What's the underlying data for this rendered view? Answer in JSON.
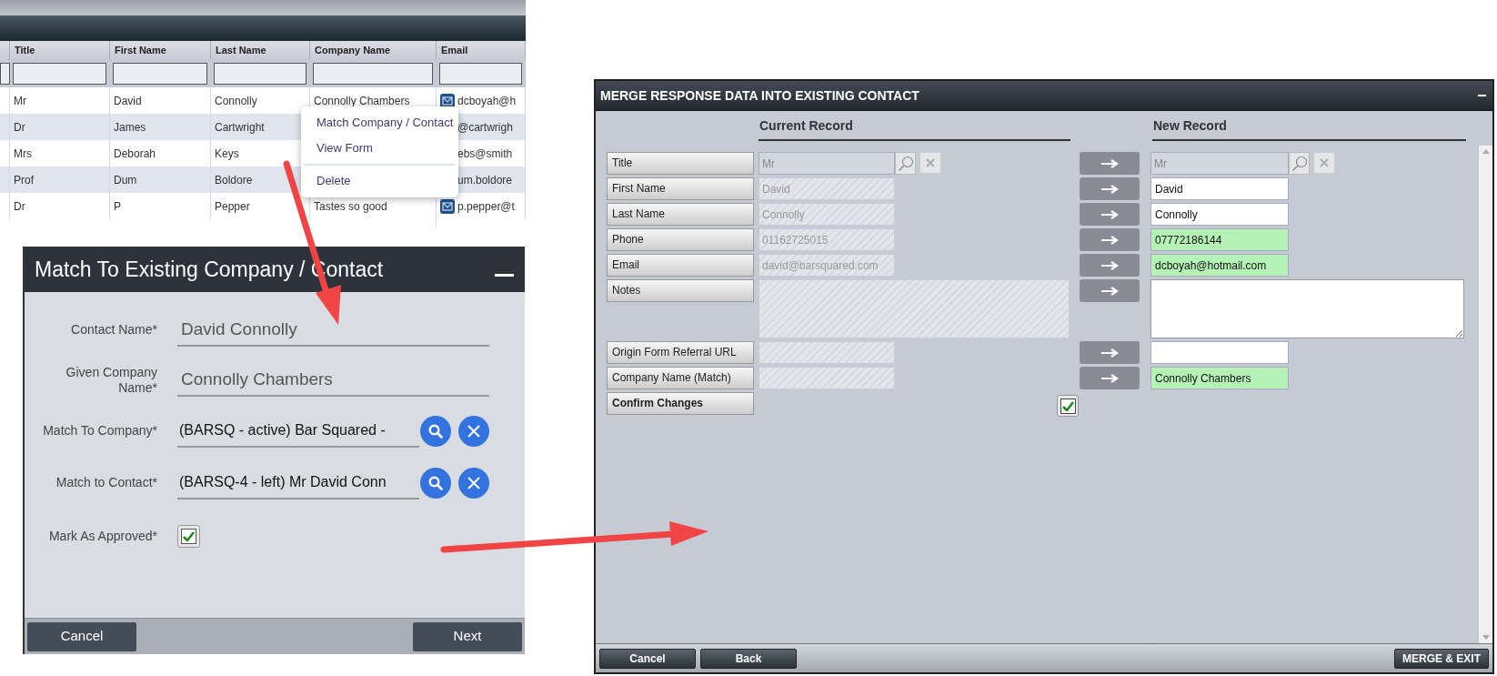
{
  "contacts_grid": {
    "columns": [
      "Title",
      "First Name",
      "Last Name",
      "Company Name",
      "Email"
    ],
    "rows": [
      {
        "title": "Mr",
        "first_name": "David",
        "last_name": "Connolly",
        "company": "Connolly Chambers",
        "email": "dcboyah@h",
        "mail_icon": true
      },
      {
        "title": "Dr",
        "first_name": "James",
        "last_name": "Cartwright",
        "email": "@cartwrigh",
        "mail_icon": false
      },
      {
        "title": "Mrs",
        "first_name": "Deborah",
        "last_name": "Keys",
        "email": "ebs@smith",
        "mail_icon": false
      },
      {
        "title": "Prof",
        "first_name": "Dum",
        "last_name": "Boldore",
        "email": "um.boldore",
        "mail_icon": false
      },
      {
        "title": "Dr",
        "first_name": "P",
        "last_name": "Pepper",
        "company": "Tastes so good",
        "email": "p.pepper@t",
        "mail_icon": true
      }
    ]
  },
  "context_menu": {
    "items": [
      {
        "kind": "item",
        "label": "Match Company / Contact"
      },
      {
        "kind": "item",
        "label": "View Form"
      },
      {
        "kind": "separator"
      },
      {
        "kind": "item",
        "label": "Delete"
      }
    ]
  },
  "match_dialog": {
    "title": "Match To Existing Company / Contact",
    "fields": [
      {
        "kind": "text",
        "label": "Contact Name*",
        "value": "David Connolly"
      },
      {
        "kind": "text",
        "label": "Given Company Name*",
        "value": "Connolly Chambers"
      },
      {
        "kind": "lookup",
        "label": "Match To Company*",
        "value": "(BARSQ - active) Bar Squared -"
      },
      {
        "kind": "lookup",
        "label": "Match to Contact*",
        "value": "(BARSQ-4 - left) Mr David Conn"
      },
      {
        "kind": "checkbox",
        "label": "Mark As Approved*",
        "checked": true
      }
    ],
    "buttons": [
      "Cancel",
      "Next"
    ]
  },
  "merge_dialog": {
    "title": "MERGE RESPONSE DATA INTO EXISTING CONTACT",
    "current_header": "Current Record",
    "new_header": "New Record",
    "rows": [
      {
        "label": "Title",
        "kind": "lookup",
        "current": "Mr",
        "new": "Mr"
      },
      {
        "label": "First Name",
        "kind": "text",
        "current": "David",
        "new": "David",
        "changed": false
      },
      {
        "label": "Last Name",
        "kind": "text",
        "current": "Connolly",
        "new": "Connolly",
        "changed": false
      },
      {
        "label": "Phone",
        "kind": "text",
        "current": "01162725015",
        "new": "07772186144",
        "changed": true
      },
      {
        "label": "Email",
        "kind": "text",
        "current": "david@barsquared.com",
        "new": "dcboyah@hotmail.com",
        "changed": true
      },
      {
        "label": "Notes",
        "kind": "textarea"
      },
      {
        "label": "Origin Form Referral URL",
        "kind": "text",
        "changed": false
      },
      {
        "label": "Company Name (Match)",
        "kind": "text",
        "new": "Connolly Chambers",
        "changed": true
      }
    ],
    "confirm": {
      "label": "Confirm Changes",
      "checked": true
    },
    "footer_buttons": [
      "Cancel",
      "Back"
    ],
    "primary_button": "MERGE & EXIT"
  }
}
